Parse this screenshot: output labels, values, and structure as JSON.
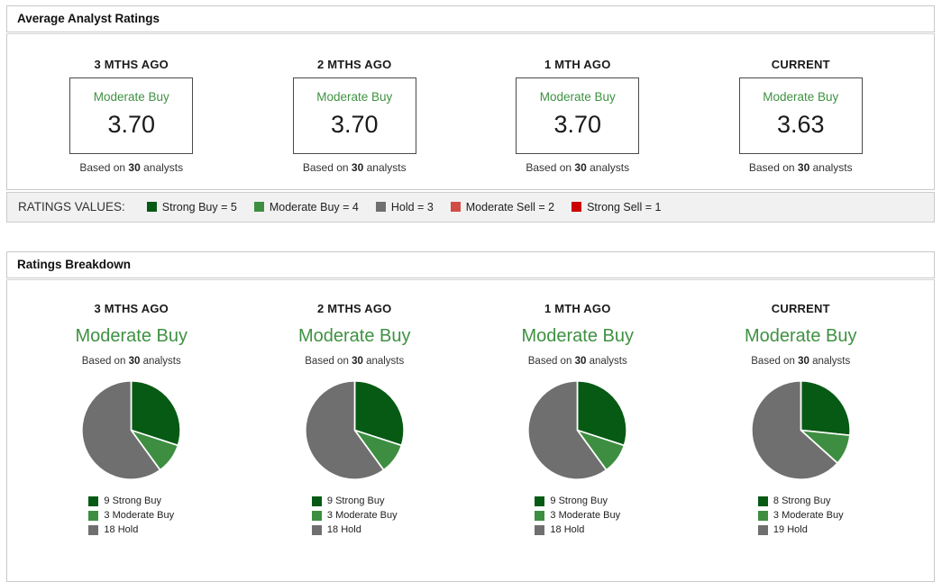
{
  "colors": {
    "strong_buy": "#075a14",
    "moderate_buy": "#3e8e41",
    "hold": "#6f6f6f",
    "moderate_sell": "#d14c44",
    "strong_sell": "#cc0000",
    "rating_text_green": "#3f9142"
  },
  "average_ratings": {
    "title": "Average Analyst Ratings",
    "columns": [
      {
        "period": "3 MTHS AGO",
        "rating_label": "Moderate Buy",
        "value": "3.70",
        "based_prefix": "Based on",
        "analyst_count": "30",
        "based_suffix": "analysts"
      },
      {
        "period": "2 MTHS AGO",
        "rating_label": "Moderate Buy",
        "value": "3.70",
        "based_prefix": "Based on",
        "analyst_count": "30",
        "based_suffix": "analysts"
      },
      {
        "period": "1 MTH AGO",
        "rating_label": "Moderate Buy",
        "value": "3.70",
        "based_prefix": "Based on",
        "analyst_count": "30",
        "based_suffix": "analysts"
      },
      {
        "period": "CURRENT",
        "rating_label": "Moderate Buy",
        "value": "3.63",
        "based_prefix": "Based on",
        "analyst_count": "30",
        "based_suffix": "analysts"
      }
    ],
    "ratings_values": {
      "label": "RATINGS VALUES:",
      "items": [
        {
          "label": "Strong Buy = 5",
          "color_key": "strong_buy"
        },
        {
          "label": "Moderate Buy = 4",
          "color_key": "moderate_buy"
        },
        {
          "label": "Hold = 3",
          "color_key": "hold"
        },
        {
          "label": "Moderate Sell = 2",
          "color_key": "moderate_sell"
        },
        {
          "label": "Strong Sell = 1",
          "color_key": "strong_sell"
        }
      ]
    }
  },
  "ratings_breakdown": {
    "title": "Ratings Breakdown",
    "columns": [
      {
        "period": "3 MTHS AGO",
        "rating_label": "Moderate Buy",
        "based_prefix": "Based on",
        "analyst_count": "30",
        "based_suffix": "analysts",
        "slices": [
          {
            "label": "9 Strong Buy",
            "value": 9,
            "color_key": "strong_buy"
          },
          {
            "label": "3 Moderate Buy",
            "value": 3,
            "color_key": "moderate_buy"
          },
          {
            "label": "18 Hold",
            "value": 18,
            "color_key": "hold"
          }
        ]
      },
      {
        "period": "2 MTHS AGO",
        "rating_label": "Moderate Buy",
        "based_prefix": "Based on",
        "analyst_count": "30",
        "based_suffix": "analysts",
        "slices": [
          {
            "label": "9 Strong Buy",
            "value": 9,
            "color_key": "strong_buy"
          },
          {
            "label": "3 Moderate Buy",
            "value": 3,
            "color_key": "moderate_buy"
          },
          {
            "label": "18 Hold",
            "value": 18,
            "color_key": "hold"
          }
        ]
      },
      {
        "period": "1 MTH AGO",
        "rating_label": "Moderate Buy",
        "based_prefix": "Based on",
        "analyst_count": "30",
        "based_suffix": "analysts",
        "slices": [
          {
            "label": "9 Strong Buy",
            "value": 9,
            "color_key": "strong_buy"
          },
          {
            "label": "3 Moderate Buy",
            "value": 3,
            "color_key": "moderate_buy"
          },
          {
            "label": "18 Hold",
            "value": 18,
            "color_key": "hold"
          }
        ]
      },
      {
        "period": "CURRENT",
        "rating_label": "Moderate Buy",
        "based_prefix": "Based on",
        "analyst_count": "30",
        "based_suffix": "analysts",
        "slices": [
          {
            "label": "8 Strong Buy",
            "value": 8,
            "color_key": "strong_buy"
          },
          {
            "label": "3 Moderate Buy",
            "value": 3,
            "color_key": "moderate_buy"
          },
          {
            "label": "19 Hold",
            "value": 19,
            "color_key": "hold"
          }
        ]
      }
    ]
  },
  "chart_data": [
    {
      "type": "table",
      "title": "Average Analyst Ratings",
      "categories": [
        "3 MTHS AGO",
        "2 MTHS AGO",
        "1 MTH AGO",
        "CURRENT"
      ],
      "values": [
        3.7,
        3.7,
        3.7,
        3.63
      ],
      "ratings": [
        "Moderate Buy",
        "Moderate Buy",
        "Moderate Buy",
        "Moderate Buy"
      ],
      "analysts": [
        30,
        30,
        30,
        30
      ],
      "scale": {
        "Strong Buy": 5,
        "Moderate Buy": 4,
        "Hold": 3,
        "Moderate Sell": 2,
        "Strong Sell": 1
      }
    },
    {
      "type": "pie",
      "title": "3 MTHS AGO",
      "subtitle": "Moderate Buy",
      "analysts": 30,
      "labels": [
        "Strong Buy",
        "Moderate Buy",
        "Hold"
      ],
      "values": [
        9,
        3,
        18
      ],
      "colors": [
        "#075a14",
        "#3e8e41",
        "#6f6f6f"
      ],
      "legend_position": "bottom"
    },
    {
      "type": "pie",
      "title": "2 MTHS AGO",
      "subtitle": "Moderate Buy",
      "analysts": 30,
      "labels": [
        "Strong Buy",
        "Moderate Buy",
        "Hold"
      ],
      "values": [
        9,
        3,
        18
      ],
      "colors": [
        "#075a14",
        "#3e8e41",
        "#6f6f6f"
      ],
      "legend_position": "bottom"
    },
    {
      "type": "pie",
      "title": "1 MTH AGO",
      "subtitle": "Moderate Buy",
      "analysts": 30,
      "labels": [
        "Strong Buy",
        "Moderate Buy",
        "Hold"
      ],
      "values": [
        9,
        3,
        18
      ],
      "colors": [
        "#075a14",
        "#3e8e41",
        "#6f6f6f"
      ],
      "legend_position": "bottom"
    },
    {
      "type": "pie",
      "title": "CURRENT",
      "subtitle": "Moderate Buy",
      "analysts": 30,
      "labels": [
        "Strong Buy",
        "Moderate Buy",
        "Hold"
      ],
      "values": [
        8,
        3,
        19
      ],
      "colors": [
        "#075a14",
        "#3e8e41",
        "#6f6f6f"
      ],
      "legend_position": "bottom"
    }
  ]
}
